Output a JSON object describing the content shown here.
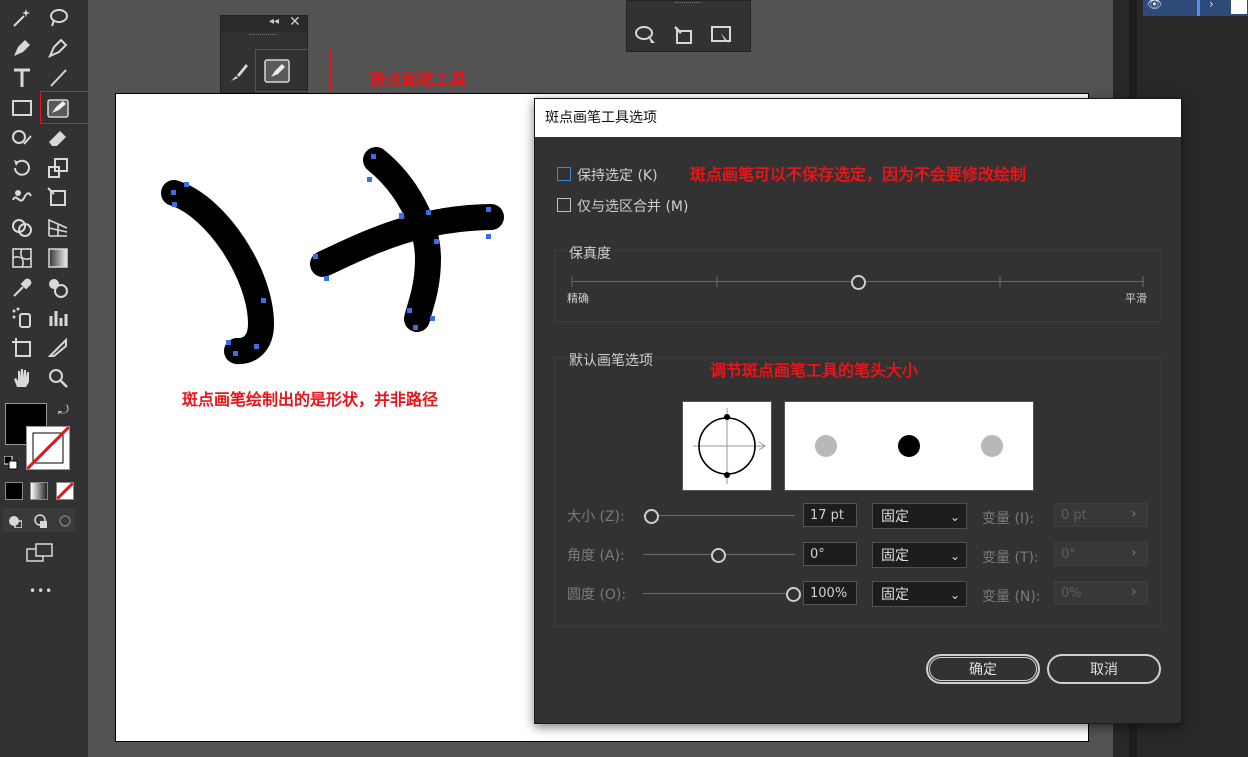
{
  "annotations": {
    "tool_note": "斑点画笔工具",
    "shape_note": "斑点画笔绘制出的是形状，并非路径",
    "keep_selected_note": "斑点画笔可以不保存选定，因为不会要修改绘制",
    "tip_size_note": "调节斑点画笔工具的笔头大小"
  },
  "toolbar": {
    "more_label": "•••"
  },
  "dialog": {
    "title": "斑点画笔工具选项",
    "keep_selected_label": "保持选定 (K)",
    "merge_only_label": "仅与选区合并 (M)",
    "fidelity": {
      "heading": "保真度",
      "left_label": "精确",
      "right_label": "平滑",
      "level": 0.5
    },
    "brush_options": {
      "heading": "默认画笔选项",
      "rows": [
        {
          "label": "大小 (Z):",
          "value": "17 pt",
          "mode": "固定",
          "variation_label": "变量 (I):",
          "variation_value": "0 pt",
          "level": 0.05
        },
        {
          "label": "角度 (A):",
          "value": "0°",
          "mode": "固定",
          "variation_label": "变量 (T):",
          "variation_value": "0°",
          "level": 0.5
        },
        {
          "label": "圆度 (O):",
          "value": "100%",
          "mode": "固定",
          "variation_label": "变量 (N):",
          "variation_value": "0%",
          "level": 1.0
        }
      ]
    },
    "ok_label": "确定",
    "cancel_label": "取消"
  },
  "colors": {
    "annotation_red": "#e8141a",
    "checkbox_focus_blue": "#3d86e0",
    "ui_dark": "#323232",
    "anchor_blue": "#3b6fe0"
  }
}
